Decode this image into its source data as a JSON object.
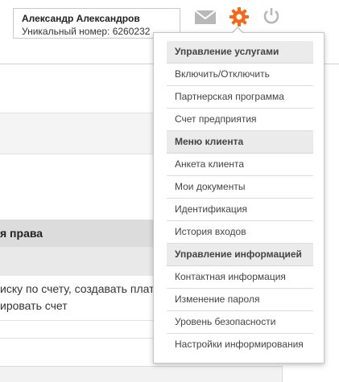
{
  "user": {
    "name": "Александр Александров",
    "id_line": "Уникальный номер: 6260232"
  },
  "icons": {
    "mail": "envelope-icon",
    "settings": "gear-icon",
    "power": "power-icon",
    "settings_color": "#f26b1d",
    "muted_color": "#b8b8b8"
  },
  "background": {
    "rights_header": "я права",
    "desc_line1": "иску по счету, создавать плате",
    "desc_line2": "ировать счет"
  },
  "menu": {
    "sections": [
      {
        "title": "Управление услугами",
        "items": [
          "Включить/Отключить",
          "Партнерская программа",
          "Счет предприятия"
        ]
      },
      {
        "title": "Меню клиента",
        "items": [
          "Анкета клиента",
          "Мои документы",
          "Идентификация",
          "История входов"
        ]
      },
      {
        "title": "Управление информацией",
        "items": [
          "Контактная информация",
          "Изменение пароля",
          "Уровень безопасности",
          "Настройки информирования"
        ]
      }
    ]
  }
}
